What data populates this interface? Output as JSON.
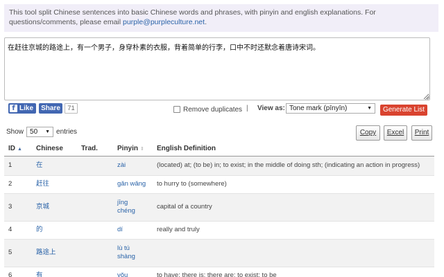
{
  "notice": {
    "text": "This tool split Chinese sentences into basic Chinese words and phrases, with pinyin and english explanations. For questions/comments, please email ",
    "email": "purple@purpleculture.net",
    "end": "."
  },
  "input": {
    "value": "在赶往京城的路途上，有一个男子，身穿朴素的衣服，背着简单的行李，口中不时还默念着唐诗宋词。"
  },
  "social": {
    "like_label": "Like",
    "share_label": "Share",
    "share_count": "71"
  },
  "options": {
    "remove_duplicates_label": "Remove duplicates",
    "separator": "|",
    "view_as_label": "View as:",
    "view_as_selected": "Tone mark (pīnyīn)",
    "generate_label": "Generate List"
  },
  "table_controls": {
    "show_label": "Show",
    "entries_value": "50",
    "entries_label": "entries",
    "copy_label": "Copy",
    "excel_label": "Excel",
    "print_label": "Print"
  },
  "table": {
    "headers": {
      "id": "ID",
      "chinese": "Chinese",
      "trad": "Trad.",
      "pinyin": "Pinyin",
      "definition": "English Definition"
    },
    "rows": [
      {
        "id": "1",
        "chinese": "在",
        "trad": "",
        "pinyin": "zài",
        "definition": "(located) at; (to be) in; to exist; in the middle of doing sth; (indicating an action in progress)"
      },
      {
        "id": "2",
        "chinese": "赶往",
        "trad": "",
        "pinyin": "gǎn wǎng",
        "definition": "to hurry to (somewhere)"
      },
      {
        "id": "3",
        "chinese": "京城",
        "trad": "",
        "pinyin": "jīng chéng",
        "definition": "capital of a country"
      },
      {
        "id": "4",
        "chinese": "的",
        "trad": "",
        "pinyin": "dí",
        "definition": "really and truly"
      },
      {
        "id": "5",
        "chinese": "路途上",
        "trad": "",
        "pinyin": "lù tú shàng",
        "definition": ""
      },
      {
        "id": "6",
        "chinese": "有",
        "trad": "",
        "pinyin": "yǒu",
        "definition": "to have; there is; there are; to exist; to be"
      }
    ]
  }
}
